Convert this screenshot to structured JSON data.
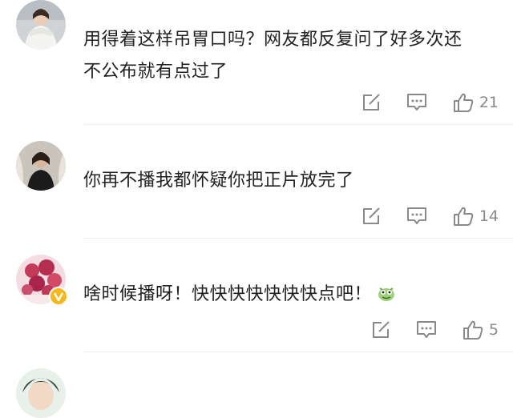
{
  "comments": [
    {
      "text_line1": "用得着这样吊胃口吗？网友都反复问了好多次还",
      "text_line2": "不公布就有点过了",
      "likes": "21"
    },
    {
      "text_line1": "你再不播我都怀疑你把正片放完了",
      "likes": "14"
    },
    {
      "text_line1": "啥时候播呀！快快快快快快快点吧！",
      "likes": "5",
      "verified": true,
      "emoji": "dinosaur-emoji"
    }
  ],
  "icons": {
    "repost": "repost-icon",
    "reply": "comment-icon",
    "like": "thumbs-up-icon"
  },
  "colors": {
    "text": "#222222",
    "icon": "#8a8a8a",
    "divider": "#ededed",
    "verified_badge": "#f5b81c"
  }
}
